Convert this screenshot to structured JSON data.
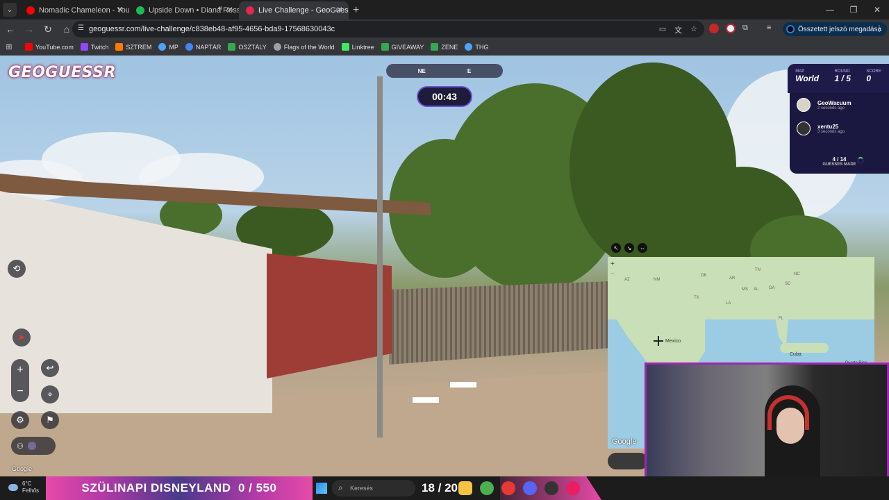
{
  "browser": {
    "tabs": [
      {
        "title": "Nomadic Chameleon - YouTube",
        "color": "#ff0000",
        "active": false,
        "audio": false
      },
      {
        "title": "Upside Down • Diana Ross",
        "color": "#1db954",
        "active": false,
        "audio": true
      },
      {
        "title": "Live Challenge - GeoGuessr",
        "color": "#e2284b",
        "active": true,
        "audio": false
      }
    ],
    "url": "geoguessr.com/live-challenge/c838eb48-af95-4656-bda9-17568630043c",
    "password_button": "Összetett jelszó megadása",
    "bookmarks": [
      {
        "label": "YouTube.com",
        "color": "#ff0000"
      },
      {
        "label": "Twitch",
        "color": "#9146ff"
      },
      {
        "label": "SZTREM",
        "color": "#ff7a00"
      },
      {
        "label": "MP",
        "color": "#4aa3ff"
      },
      {
        "label": "NAPTÁR",
        "color": "#4285f4"
      },
      {
        "label": "OSZTÁLY",
        "color": "#34a853"
      },
      {
        "label": "Flags of the World",
        "color": "#9aa0a6"
      },
      {
        "label": "Linktree",
        "color": "#43e660"
      },
      {
        "label": "GIVEAWAY",
        "color": "#34a853"
      },
      {
        "label": "ZENE",
        "color": "#34a853"
      },
      {
        "label": "THG",
        "color": "#4aa3ff"
      }
    ]
  },
  "game": {
    "logo": "GEOGUESSR",
    "compass": {
      "primary": "NE",
      "secondary": "E"
    },
    "timer": "00:43",
    "map": {
      "label": "MAP",
      "value": "World"
    },
    "round": {
      "label": "ROUND",
      "value": "1 / 5"
    },
    "score": {
      "label": "SCORE",
      "value": "0"
    },
    "players": [
      {
        "name": "GeoWacuum",
        "time": "2 seconds ago"
      },
      {
        "name": "xentu25",
        "time": "3 seconds ago"
      }
    ],
    "guesses": {
      "count": "4 / 14",
      "label": "GUESSES MADE"
    },
    "watermark": "Google"
  },
  "minimap": {
    "state_labels": [
      "AZ",
      "NM",
      "TX",
      "OK",
      "AR",
      "TN",
      "MS",
      "AL",
      "GA",
      "SC",
      "NC",
      "LA",
      "FL"
    ],
    "countries": {
      "mexico": "Mexico",
      "cuba": "Cuba",
      "pr": "Puerto Rico"
    },
    "zoom_in": "+",
    "zoom_out": "−",
    "watermark": "Google"
  },
  "taskbar": {
    "weather_temp": "6°C",
    "weather_desc": "Felhős",
    "banner_title": "SZÜLINAPI DISNEYLAND",
    "banner_count": "0 / 550",
    "search_placeholder": "Keresés",
    "counter2": "18 / 20"
  }
}
